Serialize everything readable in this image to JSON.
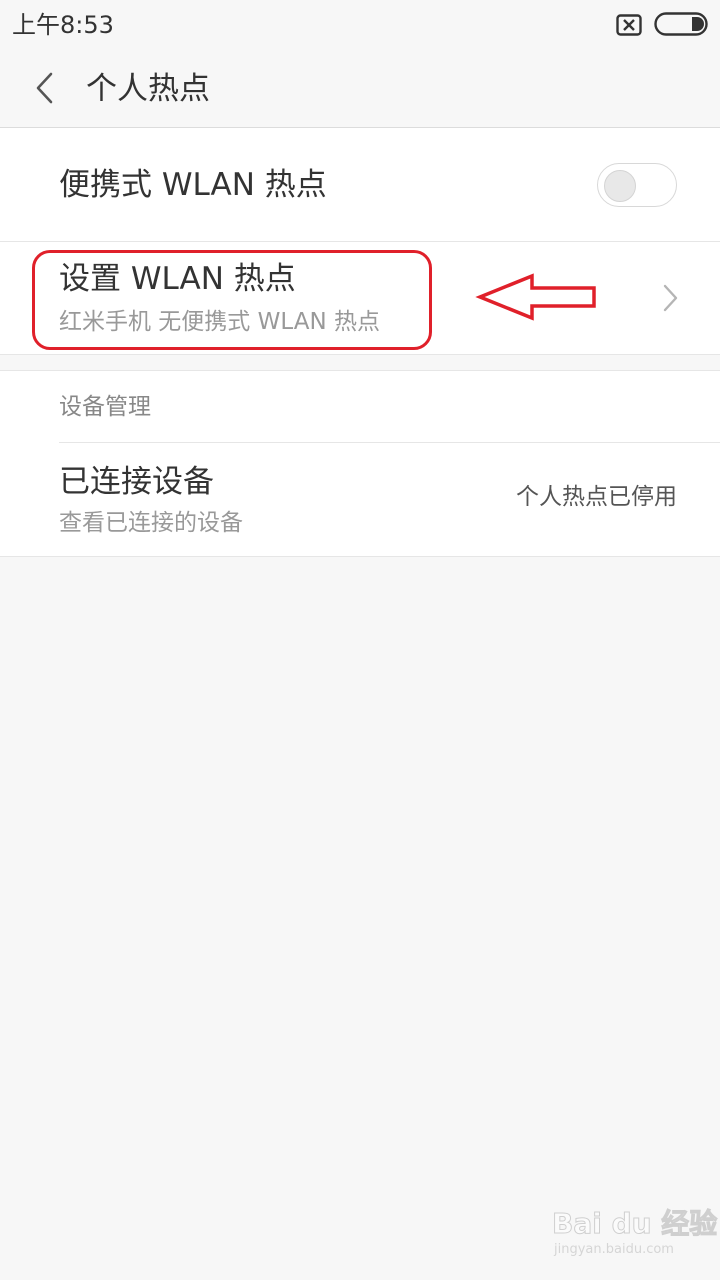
{
  "status_bar": {
    "time": "上午8:53",
    "sim_icon": "sim-off-icon",
    "battery_icon": "battery-icon"
  },
  "title_bar": {
    "back_icon": "chevron-left-icon",
    "title": "个人热点"
  },
  "hotspot_toggle": {
    "label": "便携式 WLAN 热点",
    "enabled": false
  },
  "setup_hotspot": {
    "title": "设置 WLAN 热点",
    "subtitle": "红米手机 无便携式 WLAN 热点"
  },
  "device_management": {
    "header": "设备管理",
    "connected_devices": {
      "title": "已连接设备",
      "subtitle": "查看已连接的设备",
      "status": "个人热点已停用"
    }
  },
  "annotation": {
    "color": "#e0202a"
  },
  "watermark": {
    "logo": "Bai du 经验",
    "url": "jingyan.baidu.com"
  },
  "colors": {
    "background": "#f7f7f7",
    "card": "#ffffff",
    "primary_text": "#333333",
    "secondary_text": "#999999"
  }
}
